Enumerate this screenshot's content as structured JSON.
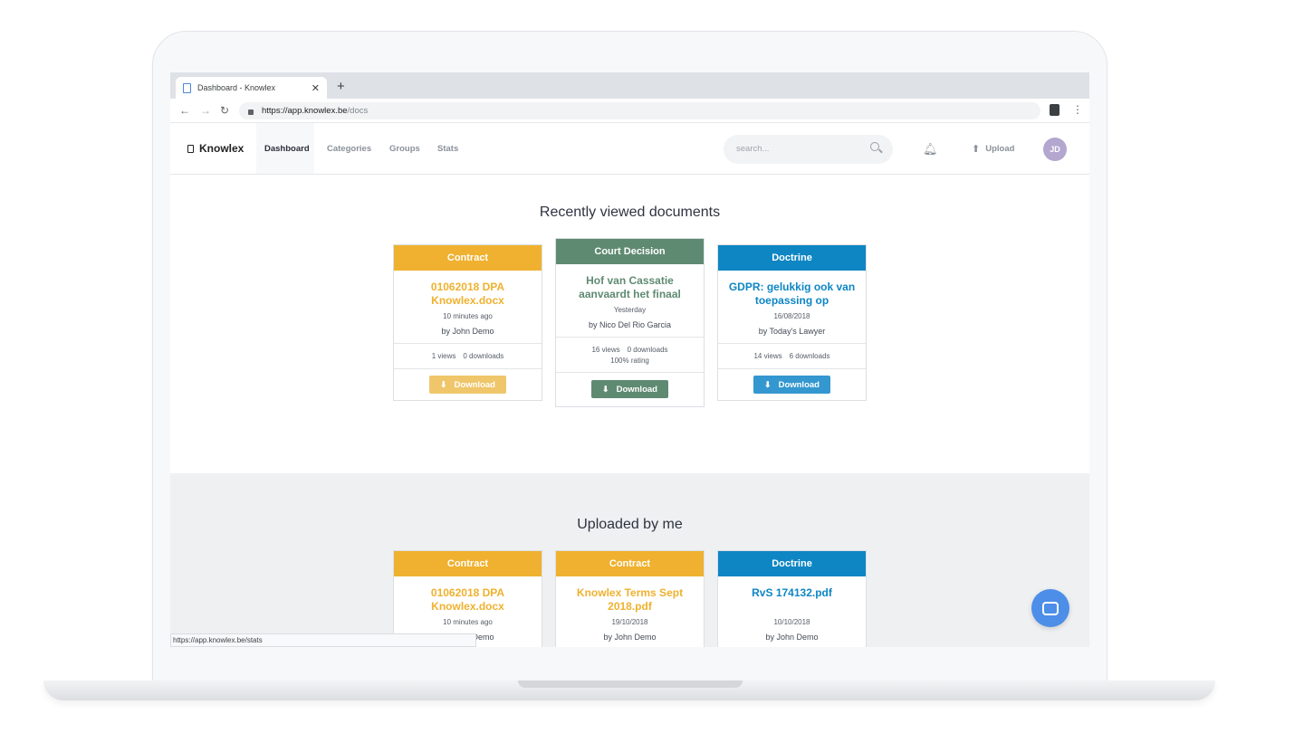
{
  "browser": {
    "tab_title": "Dashboard - Knowlex",
    "tab_close": "✕",
    "new_tab": "+",
    "url_host": "https://app.knowlex.be",
    "url_path": "/docs",
    "back": "←",
    "forward": "→",
    "reload": "↻",
    "menu": "⋮",
    "status_url": "https://app.knowlex.be/stats"
  },
  "header": {
    "brand": "Knowlex",
    "nav": [
      "Dashboard",
      "Categories",
      "Groups",
      "Stats"
    ],
    "search_placeholder": "search...",
    "upload_label": "Upload",
    "avatar_initials": "JD"
  },
  "colors": {
    "contract": "#efb12f",
    "court_decision": "#5f8a72",
    "doctrine": "#0e86c4"
  },
  "recent": {
    "title": "Recently viewed documents",
    "cards": [
      {
        "category": "Contract",
        "title": "01062018 DPA Knowlex.docx",
        "date": "10 minutes ago",
        "author": "by John Demo",
        "views": "1 views",
        "downloads": "0 downloads",
        "rating": "",
        "button": "Download"
      },
      {
        "category": "Court Decision",
        "title": "Hof van Cassatie aanvaardt het finaal",
        "date": "Yesterday",
        "author": "by Nico Del Rio Garcia",
        "views": "16 views",
        "downloads": "0 downloads",
        "rating": "100% rating",
        "button": "Download"
      },
      {
        "category": "Doctrine",
        "title": "GDPR: gelukkig ook van toepassing op",
        "date": "16/08/2018",
        "author": "by Today's Lawyer",
        "views": "14 views",
        "downloads": "6 downloads",
        "rating": "",
        "button": "Download"
      }
    ]
  },
  "uploaded": {
    "title": "Uploaded by me",
    "cards": [
      {
        "category": "Contract",
        "title": "01062018 DPA Knowlex.docx",
        "date": "10 minutes ago",
        "author": "by John Demo"
      },
      {
        "category": "Contract",
        "title": "Knowlex Terms Sept 2018.pdf",
        "date": "19/10/2018",
        "author": "by John Demo"
      },
      {
        "category": "Doctrine",
        "title": "RvS 174132.pdf",
        "date": "10/10/2018",
        "author": "by John Demo"
      }
    ]
  }
}
